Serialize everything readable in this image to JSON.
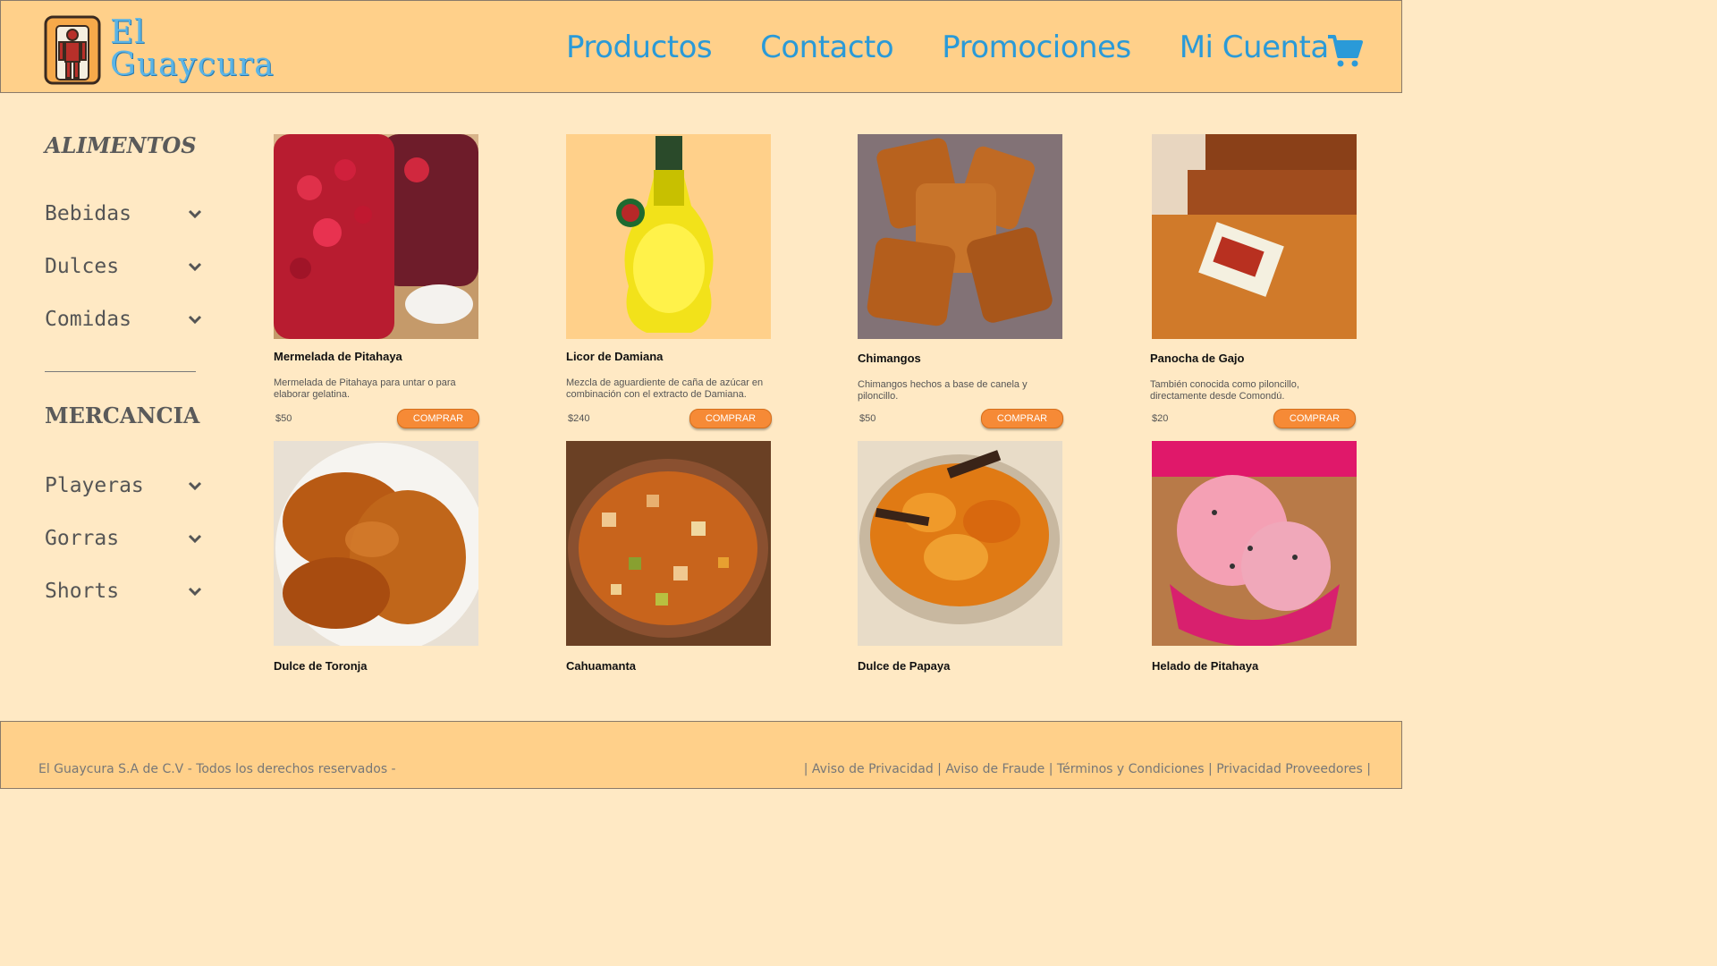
{
  "brand": {
    "line1": "El",
    "line2": "Guaycura"
  },
  "nav": [
    {
      "label": "Productos"
    },
    {
      "label": "Contacto"
    },
    {
      "label": "Promociones"
    },
    {
      "label": "Mi Cuenta"
    }
  ],
  "colors": {
    "header_bg": "#ffd08a",
    "page_bg": "#ffe9c4",
    "accent": "#2a9ad8",
    "button": "#f68a36"
  },
  "sidebar": {
    "section1": {
      "title": "ALIMENTOS",
      "items": [
        {
          "label": "Bebidas"
        },
        {
          "label": "Dulces"
        },
        {
          "label": "Comidas"
        }
      ]
    },
    "section2": {
      "title": "MERCANCIA",
      "items": [
        {
          "label": "Playeras"
        },
        {
          "label": "Gorras"
        },
        {
          "label": "Shorts"
        }
      ]
    }
  },
  "buy_label": "COMPRAR",
  "products": [
    {
      "name": "Mermelada de Pitahaya",
      "description": "Mermelada de Pitahaya para untar o para elaborar gelatina.",
      "price": "$50",
      "image": "pitahaya-jam-photo"
    },
    {
      "name": "Licor de Damiana",
      "description": "Mezcla de aguardiente de caña de azúcar en combinación con el extracto de Damiana.",
      "price": "$240",
      "image": "damiana-bottle-photo"
    },
    {
      "name": "Chimangos",
      "description": "Chimangos hechos a base de canela y piloncillo.",
      "price": "$50",
      "image": "chimangos-photo"
    },
    {
      "name": "Panocha de Gajo",
      "description": "También conocida como piloncillo, directamente desde Comondú.",
      "price": "$20",
      "image": "panocha-photo"
    },
    {
      "name": "Dulce de Toronja",
      "image": "toronja-photo"
    },
    {
      "name": "Cahuamanta",
      "image": "cahuamanta-photo"
    },
    {
      "name": "Dulce de Papaya",
      "image": "papaya-photo"
    },
    {
      "name": "Helado de Pitahaya",
      "image": "helado-photo"
    }
  ],
  "footer": {
    "copyright": "El Guaycura S.A de C.V - Todos los derechos reservados -",
    "links": [
      {
        "label": "Aviso de Privacidad"
      },
      {
        "label": "Aviso de Fraude"
      },
      {
        "label": "Términos y Condiciones"
      },
      {
        "label": "Privacidad Proveedores"
      }
    ]
  }
}
